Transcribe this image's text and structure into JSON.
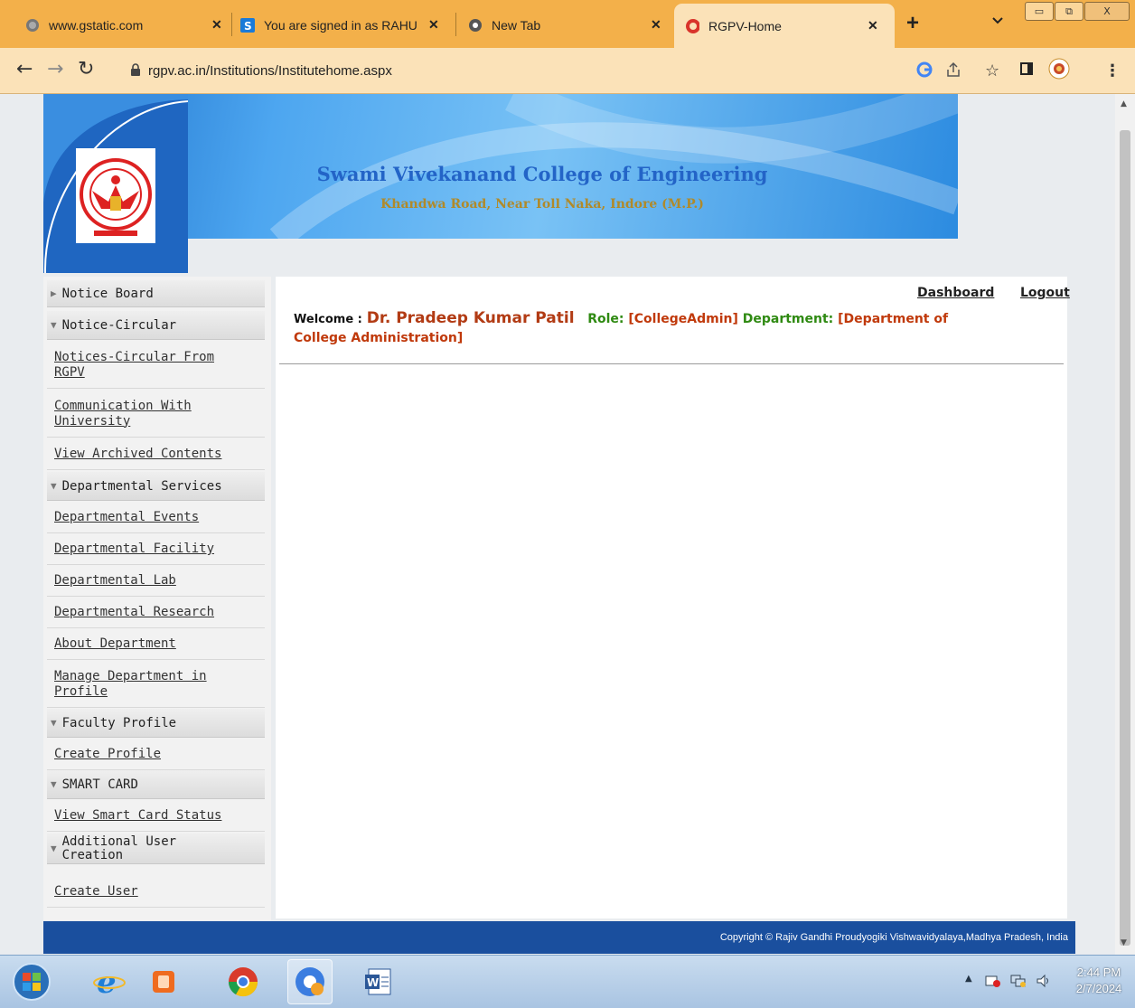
{
  "browser": {
    "tabs": [
      {
        "title": "www.gstatic.com",
        "icon": "globe-icon"
      },
      {
        "title": "You are signed in as RAHU",
        "icon": "s-app-icon"
      },
      {
        "title": "New Tab",
        "icon": "chrome-icon"
      },
      {
        "title": "RGPV-Home",
        "icon": "rgpv-icon",
        "active": true
      }
    ],
    "new_tab_label": "+",
    "tab_dropdown_label": "⌄",
    "url": "rgpv.ac.in/Institutions/Institutehome.aspx",
    "window_buttons": {
      "minimize": "▭",
      "maximize": "⧉",
      "close": "X"
    }
  },
  "header": {
    "college_name": "Swami Vivekanand College of Engineering",
    "college_address": "Khandwa Road, Near Toll Naka, Indore (M.P.)"
  },
  "sidebar": {
    "notice_board": "Notice Board",
    "notice_circular": "Notice-Circular",
    "notices_from_rgpv": "Notices-Circular From RGPV",
    "communication": "Communication With University",
    "archived": "View Archived Contents",
    "departmental_services": "Departmental Services",
    "dept_events": "Departmental Events",
    "dept_facility": "Departmental Facility",
    "dept_lab": "Departmental Lab",
    "dept_research": "Departmental Research",
    "about_dept": "About Department",
    "manage_dept": "Manage Department in Profile",
    "faculty_profile": "Faculty Profile",
    "create_profile": "Create Profile",
    "smart_card": "SMART CARD",
    "smart_card_status": "View Smart Card Status",
    "additional_user": "Additional User Creation",
    "create_user": "Create User"
  },
  "content": {
    "dashboard_link": "Dashboard",
    "logout_link": "Logout",
    "welcome_label": "Welcome :",
    "user_name": "Dr. Pradeep Kumar Patil",
    "role_label": "Role:",
    "role_value": "[CollegeAdmin]",
    "department_label": "Department:",
    "department_value": "[Department of College Administration]"
  },
  "footer": {
    "copyright": "Copyright © Rajiv Gandhi Proudyogiki Vishwavidyalaya,Madhya Pradesh, India"
  },
  "taskbar": {
    "time": "2:44 PM",
    "date": "2/7/2024"
  }
}
